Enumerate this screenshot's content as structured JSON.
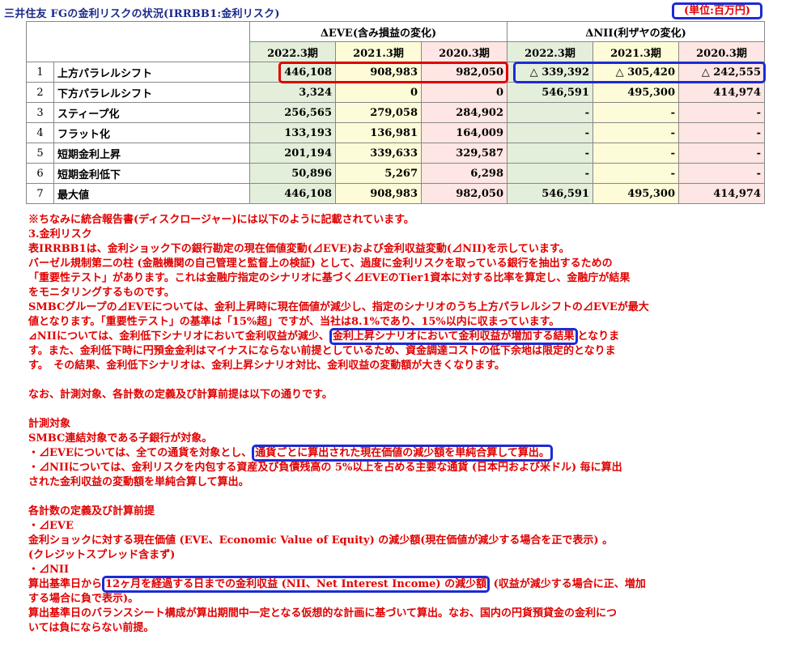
{
  "title": "三井住友 FGの金利リスクの状況(IRRBB1:金利リスク)",
  "unit": "(単位:百万円)",
  "table": {
    "eve_header": "ΔEVE(含み損益の変化)",
    "nii_header": "ΔNII(利ザヤの変化)",
    "periods": [
      "2022.3期",
      "2021.3期",
      "2020.3期",
      "2022.3期",
      "2021.3期",
      "2020.3期"
    ],
    "rows": [
      {
        "idx": "1",
        "label": "上方パラレルシフト",
        "v": [
          "446,108",
          "908,983",
          "982,050",
          "△ 339,392",
          "△ 305,420",
          "△ 242,555"
        ]
      },
      {
        "idx": "2",
        "label": "下方パラレルシフト",
        "v": [
          "3,324",
          "0",
          "0",
          "546,591",
          "495,300",
          "414,974"
        ]
      },
      {
        "idx": "3",
        "label": "スティープ化",
        "v": [
          "256,565",
          "279,058",
          "284,902",
          "-",
          "-",
          "-"
        ]
      },
      {
        "idx": "4",
        "label": "フラット化",
        "v": [
          "133,193",
          "136,981",
          "164,009",
          "-",
          "-",
          "-"
        ]
      },
      {
        "idx": "5",
        "label": "短期金利上昇",
        "v": [
          "201,194",
          "339,633",
          "329,587",
          "-",
          "-",
          "-"
        ]
      },
      {
        "idx": "6",
        "label": "短期金利低下",
        "v": [
          "50,896",
          "5,267",
          "6,298",
          "-",
          "-",
          "-"
        ]
      },
      {
        "idx": "7",
        "label": "最大値",
        "v": [
          "446,108",
          "908,983",
          "982,050",
          "546,591",
          "495,300",
          "414,974"
        ]
      }
    ]
  },
  "notes": {
    "n0": "※ちなみに統合報告書(ディスクロージャー)には以下のように記載されています。",
    "n1": "3.金利リスク",
    "n2": "表IRRBB1は、金利ショック下の銀行勘定の現在価値変動(⊿EVE)および金利収益変動(⊿NII)を示しています。",
    "n3": "バーゼル規制第二の柱 (金融機関の自己管理と監督上の検証) として、過度に金利リスクを取っている銀行を抽出するための",
    "n4": "「重要性テスト」があります。これは金融庁指定のシナリオに基づく⊿EVEのTier1資本に対する比率を算定し、金融庁が結果",
    "n5": "をモニタリングするものです。",
    "n6": "SMBCグループの⊿EVEについては、金利上昇時に現在価値が減少し、指定のシナリオのうち上方パラレルシフトの⊿EVEが最大",
    "n7": "値となります。「重要性テスト」の基準は「15%超」ですが、当社は8.1%であり、15%以内に収まっています。",
    "n8a": "⊿NIIについては、金利低下シナリオにおいて金利収益が減少、",
    "n8b": "金利上昇シナリオにおいて金利収益が増加する結果",
    "n8c": "となりま",
    "n9": "す。また、金利低下時に円預金金利はマイナスにならない前提としているため、資金調達コストの低下余地は限定的となりま",
    "n10": "す。　その結果、金利低下シナリオは、金利上昇シナリオ対比、金利収益の変動額が大きくなります。",
    "n11": "なお、計測対象、各計数の定義及び計算前提は以下の通りです。",
    "n12": "計測対象",
    "n13": "SMBC連結対象である子銀行が対象。",
    "n14a": "・⊿EVEについては、全ての通貨を対象とし、",
    "n14b": "通貨ごとに算出された現在価値の減少額を単純合算して算出。",
    "n15": "・⊿NIIについては、金利リスクを内包する資産及び負債残高の 5%以上を占める主要な通貨 (日本円および米ドル) 毎に算出",
    "n16": "された金利収益の変動額を単純合算して算出。",
    "n17": "各計数の定義及び計算前提",
    "n18": "・⊿EVE",
    "n19": "金利ショックに対する現在価値 (EVE、Economic Value of Equity) の減少額(現在価値が減少する場合を正で表示) 。",
    "n20": " (クレジットスプレッド含まず)",
    "n21": "・⊿NII",
    "n22a": "算出基準日から",
    "n22b": "12ヶ月を経過する日までの金利収益 (NII、Net Interest Income) の減少額",
    "n22c": " (収益が減少する場合に正、増加",
    "n23": "する場合に負で表示)。",
    "n24": "算出基準日のバランスシート構成が算出期間中一定となる仮想的な計画に基づいて算出。なお、国内の円貨預貸金の金利につ",
    "n25": "いては負にならない前提。"
  }
}
